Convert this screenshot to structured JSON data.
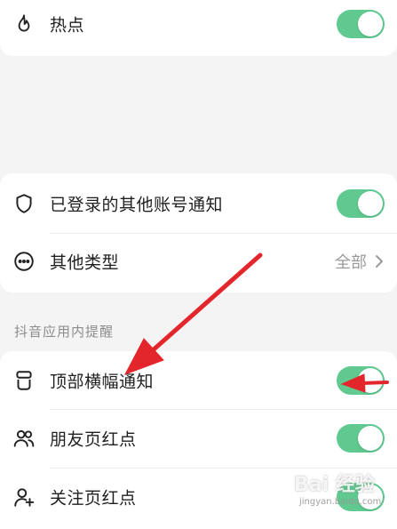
{
  "top_section": {
    "rows": [
      {
        "label": "热点",
        "icon": "flame-icon",
        "toggle": true
      }
    ]
  },
  "account_section": {
    "rows": [
      {
        "label": "已登录的其他账号通知",
        "icon": "shield-icon",
        "toggle": true
      },
      {
        "label": "其他类型",
        "icon": "more-circle-icon",
        "value": "全部"
      }
    ]
  },
  "in_app_section": {
    "title": "抖音应用内提醒",
    "rows": [
      {
        "label": "顶部横幅通知",
        "icon": "banner-icon",
        "toggle": true
      },
      {
        "label": "朋友页红点",
        "icon": "friends-icon",
        "toggle": true
      },
      {
        "label": "关注页红点",
        "icon": "follow-icon",
        "toggle": true
      }
    ]
  },
  "watermark": {
    "main": "Bai 经验",
    "sub": "jingyan.baidu.com"
  },
  "colors": {
    "toggle_on": "#5fc98f",
    "arrow": "#e3262c",
    "background": "#f4f4f5"
  }
}
